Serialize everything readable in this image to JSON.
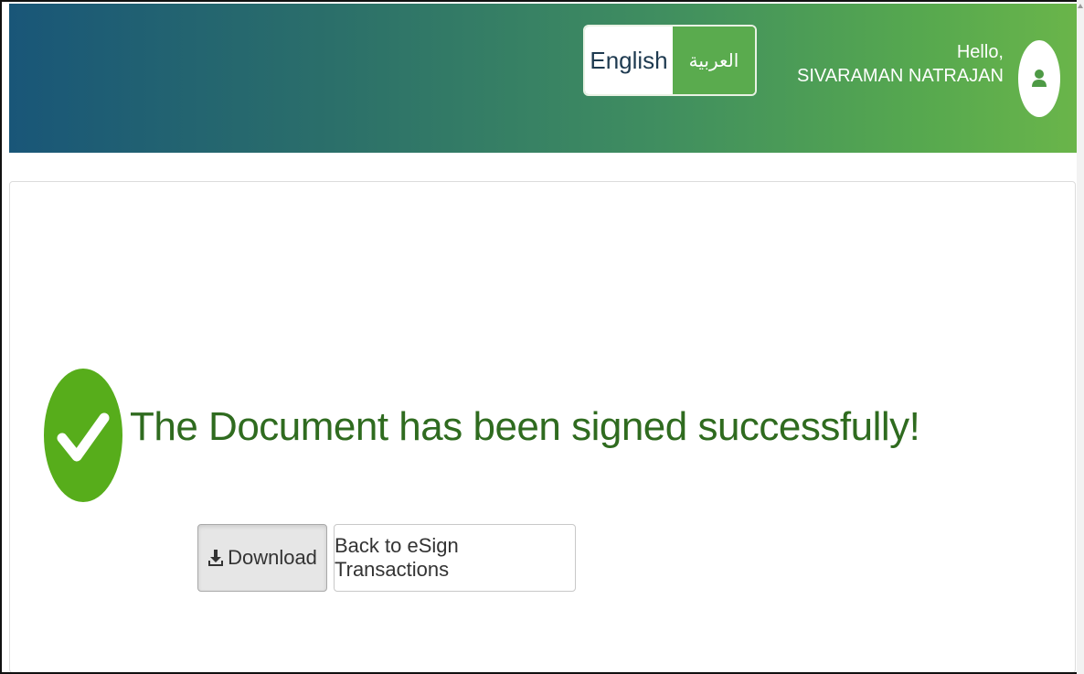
{
  "header": {
    "language": {
      "english_label": "English",
      "arabic_label": "العربية"
    },
    "greeting": "Hello,",
    "user_name": "SIVARAMAN NATRAJAN"
  },
  "main": {
    "success_message": "The Document has been signed successfully!",
    "download_label": "Download",
    "back_label": "Back to eSign Transactions"
  },
  "colors": {
    "header_gradient_start": "#195678",
    "header_gradient_end": "#6ab54a",
    "success_green": "#57ad1b",
    "message_text": "#2f6b1f"
  },
  "icons": [
    "check-circle-icon",
    "user-icon",
    "download-icon"
  ]
}
